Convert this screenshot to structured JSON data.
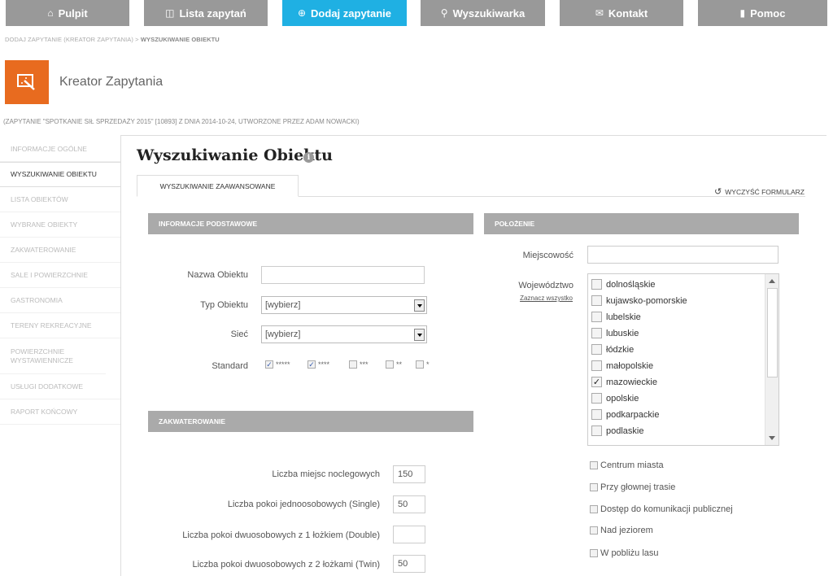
{
  "nav": [
    {
      "label": "Pulpit",
      "icon": "home-icon",
      "active": false
    },
    {
      "label": "Lista zapytań",
      "icon": "inbox-icon",
      "active": false
    },
    {
      "label": "Dodaj zapytanie",
      "icon": "plus-circle-icon",
      "active": true
    },
    {
      "label": "Wyszukiwarka",
      "icon": "search-icon",
      "active": false
    },
    {
      "label": "Kontakt",
      "icon": "mail-icon",
      "active": false
    },
    {
      "label": "Pomoc",
      "icon": "book-icon",
      "active": false
    }
  ],
  "breadcrumb": {
    "part1": "DODAJ ZAPYTANIE (KREATOR ZAPYTANIA) > ",
    "part2": "WYSZUKIWANIE OBIEKTU"
  },
  "wizard": {
    "title": "Kreator Zapytania",
    "icon": "wizard-icon"
  },
  "subtitle": "(ZAPYTANIE \"SPOTKANIE SIŁ SPRZEDAŻY 2015\" [10893] Z DNIA 2014-10-24, UTWORZONE PRZEZ ADAM NOWACKI)",
  "sidebar": [
    {
      "label": "INFORMACJE OGÓLNE"
    },
    {
      "label": "WYSZUKIWANIE OBIEKTU"
    },
    {
      "label": "LISTA OBIEKTÓW"
    },
    {
      "label": "WYBRANE OBIEKTY"
    },
    {
      "label": "ZAKWATEROWANIE"
    },
    {
      "label": "SALE I POWIERZCHNIE"
    },
    {
      "label": "GASTRONOMIA"
    },
    {
      "label": "TERENY REKREACYJNE"
    },
    {
      "label": "POWIERZCHNIE WYSTAWIENNICZE"
    },
    {
      "label": "USŁUGI DODATKOWE"
    },
    {
      "label": "RAPORT KOŃCOWY"
    }
  ],
  "page": {
    "title": "Wyszukiwanie Obiektu",
    "tab": "WYSZUKIWANIE ZAAWANSOWANE",
    "clear": "WYCZYŚĆ FORMULARZ"
  },
  "basic": {
    "header": "INFORMACJE PODSTAWOWE",
    "name_label": "Nazwa Obiektu",
    "name_value": "",
    "type_label": "Typ Obiektu",
    "type_value": "[wybierz]",
    "chain_label": "Sieć",
    "chain_value": "[wybierz]",
    "standard_label": "Standard",
    "standards": [
      {
        "label": "*****",
        "checked": true
      },
      {
        "label": "****",
        "checked": true
      },
      {
        "label": "***",
        "checked": false
      },
      {
        "label": "**",
        "checked": false
      },
      {
        "label": "*",
        "checked": false
      }
    ]
  },
  "accommodation": {
    "header": "ZAKWATEROWANIE",
    "fields": [
      {
        "label": "Liczba miejsc noclegowych",
        "value": "150"
      },
      {
        "label": "Liczba pokoi jednoosobowych (Single)",
        "value": "50"
      },
      {
        "label": "Liczba pokoi dwuosobowych z 1 łożkiem (Double)",
        "value": ""
      },
      {
        "label": "Liczba pokoi dwuosobowych z 2 łożkami (Twin)",
        "value": "50"
      }
    ]
  },
  "location": {
    "header": "POŁOŻENIE",
    "city_label": "Miejscowość",
    "city_value": "",
    "region_label": "Województwo",
    "select_all": "Zaznacz wszystko",
    "regions": [
      {
        "label": "dolnośląskie",
        "checked": false
      },
      {
        "label": "kujawsko-pomorskie",
        "checked": false
      },
      {
        "label": "lubelskie",
        "checked": false
      },
      {
        "label": "lubuskie",
        "checked": false
      },
      {
        "label": "łódzkie",
        "checked": false
      },
      {
        "label": "małopolskie",
        "checked": false
      },
      {
        "label": "mazowieckie",
        "checked": true
      },
      {
        "label": "opolskie",
        "checked": false
      },
      {
        "label": "podkarpackie",
        "checked": false
      },
      {
        "label": "podlaskie",
        "checked": false
      }
    ],
    "extras": [
      {
        "label": "Centrum miasta",
        "checked": false
      },
      {
        "label": "Przy głownej trasie",
        "checked": false
      },
      {
        "label": "Dostęp do komunikacji publicznej",
        "checked": false
      },
      {
        "label": "Nad jeziorem",
        "checked": false
      },
      {
        "label": "W pobliżu lasu",
        "checked": false
      }
    ]
  }
}
